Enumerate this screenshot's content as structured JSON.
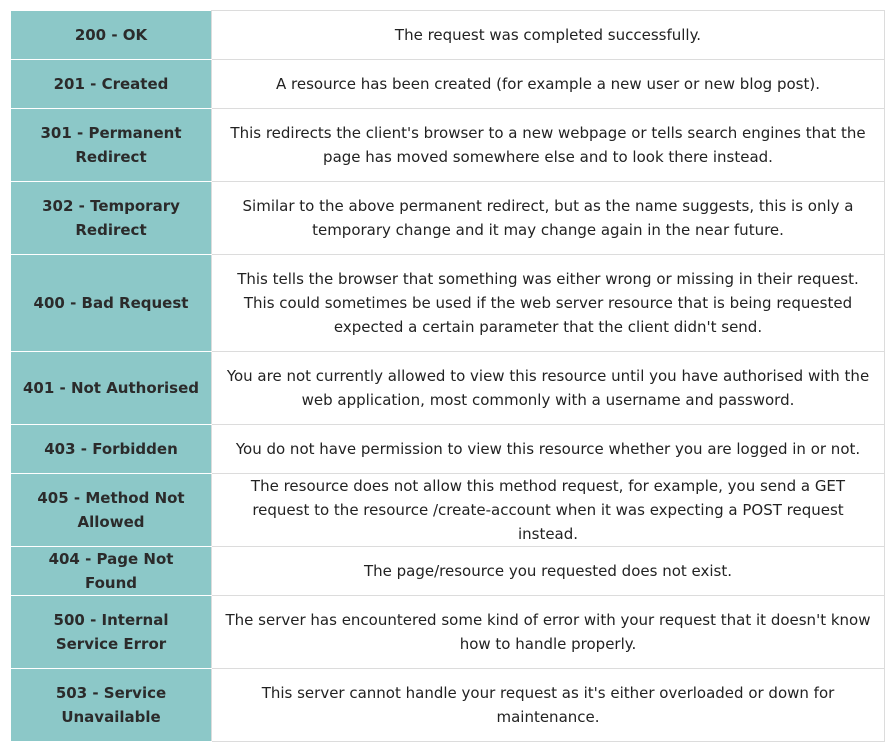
{
  "rows": [
    {
      "code": "200 - OK",
      "description": "The request was completed successfully."
    },
    {
      "code": "201 - Created",
      "description": "A resource has been created (for example a new user or new blog post)."
    },
    {
      "code": "301 - Permanent Redirect",
      "description": "This redirects the client's browser to a new webpage or tells search engines that the page has moved somewhere else and to look there instead."
    },
    {
      "code": "302 - Temporary Redirect",
      "description": "Similar to the above permanent redirect, but as the name suggests, this is only a temporary change and it may change again in the near future."
    },
    {
      "code": "400 - Bad Request",
      "description": "This tells the browser that something was either wrong or missing in their request. This could sometimes be used if the web server resource that is being requested expected a certain parameter that the client didn't send."
    },
    {
      "code": "401 - Not Authorised",
      "description": "You are not currently allowed to view this resource until you have authorised with the web application, most commonly with a username and password."
    },
    {
      "code": "403 - Forbidden",
      "description": "You do not have permission to view this resource whether you are logged in or not."
    },
    {
      "code": "405 - Method Not Allowed",
      "description": "The resource does not allow this method request, for example, you send a GET request to the resource /create-account when it was expecting a POST request instead."
    },
    {
      "code": "404 - Page Not Found",
      "description": "The page/resource you requested does not exist."
    },
    {
      "code": "500 - Internal Service Error",
      "description": "The server has encountered some kind of error with your request that it doesn't know how to handle properly."
    },
    {
      "code": "503 - Service Unavailable",
      "description": "This server cannot handle your request as it's either overloaded or down for maintenance."
    }
  ]
}
